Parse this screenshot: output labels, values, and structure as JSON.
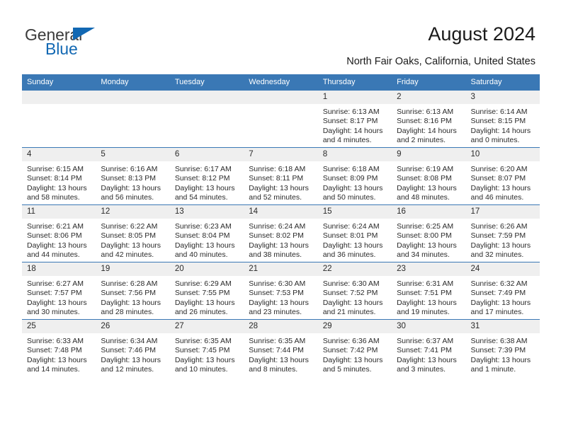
{
  "brand": {
    "name_top": "General",
    "name_bottom": "Blue",
    "triangle_color": "#1268b3",
    "top_color": "#3b3b3b"
  },
  "header": {
    "title": "August 2024",
    "subtitle": "North Fair Oaks, California, United States"
  },
  "theme": {
    "header_blue": "#3a78b5",
    "daynum_band": "#efefef",
    "text": "#2a2a2a"
  },
  "weekday_headers": [
    "Sunday",
    "Monday",
    "Tuesday",
    "Wednesday",
    "Thursday",
    "Friday",
    "Saturday"
  ],
  "labels": {
    "sunrise": "Sunrise:",
    "sunset": "Sunset:",
    "daylight": "Daylight:"
  },
  "weeks": [
    [
      {
        "day": "",
        "empty": true
      },
      {
        "day": "",
        "empty": true
      },
      {
        "day": "",
        "empty": true
      },
      {
        "day": "",
        "empty": true
      },
      {
        "day": "1",
        "sunrise": "Sunrise: 6:13 AM",
        "sunset": "Sunset: 8:17 PM",
        "daylight": "Daylight: 14 hours and 4 minutes."
      },
      {
        "day": "2",
        "sunrise": "Sunrise: 6:13 AM",
        "sunset": "Sunset: 8:16 PM",
        "daylight": "Daylight: 14 hours and 2 minutes."
      },
      {
        "day": "3",
        "sunrise": "Sunrise: 6:14 AM",
        "sunset": "Sunset: 8:15 PM",
        "daylight": "Daylight: 14 hours and 0 minutes."
      }
    ],
    [
      {
        "day": "4",
        "sunrise": "Sunrise: 6:15 AM",
        "sunset": "Sunset: 8:14 PM",
        "daylight": "Daylight: 13 hours and 58 minutes."
      },
      {
        "day": "5",
        "sunrise": "Sunrise: 6:16 AM",
        "sunset": "Sunset: 8:13 PM",
        "daylight": "Daylight: 13 hours and 56 minutes."
      },
      {
        "day": "6",
        "sunrise": "Sunrise: 6:17 AM",
        "sunset": "Sunset: 8:12 PM",
        "daylight": "Daylight: 13 hours and 54 minutes."
      },
      {
        "day": "7",
        "sunrise": "Sunrise: 6:18 AM",
        "sunset": "Sunset: 8:11 PM",
        "daylight": "Daylight: 13 hours and 52 minutes."
      },
      {
        "day": "8",
        "sunrise": "Sunrise: 6:18 AM",
        "sunset": "Sunset: 8:09 PM",
        "daylight": "Daylight: 13 hours and 50 minutes."
      },
      {
        "day": "9",
        "sunrise": "Sunrise: 6:19 AM",
        "sunset": "Sunset: 8:08 PM",
        "daylight": "Daylight: 13 hours and 48 minutes."
      },
      {
        "day": "10",
        "sunrise": "Sunrise: 6:20 AM",
        "sunset": "Sunset: 8:07 PM",
        "daylight": "Daylight: 13 hours and 46 minutes."
      }
    ],
    [
      {
        "day": "11",
        "sunrise": "Sunrise: 6:21 AM",
        "sunset": "Sunset: 8:06 PM",
        "daylight": "Daylight: 13 hours and 44 minutes."
      },
      {
        "day": "12",
        "sunrise": "Sunrise: 6:22 AM",
        "sunset": "Sunset: 8:05 PM",
        "daylight": "Daylight: 13 hours and 42 minutes."
      },
      {
        "day": "13",
        "sunrise": "Sunrise: 6:23 AM",
        "sunset": "Sunset: 8:04 PM",
        "daylight": "Daylight: 13 hours and 40 minutes."
      },
      {
        "day": "14",
        "sunrise": "Sunrise: 6:24 AM",
        "sunset": "Sunset: 8:02 PM",
        "daylight": "Daylight: 13 hours and 38 minutes."
      },
      {
        "day": "15",
        "sunrise": "Sunrise: 6:24 AM",
        "sunset": "Sunset: 8:01 PM",
        "daylight": "Daylight: 13 hours and 36 minutes."
      },
      {
        "day": "16",
        "sunrise": "Sunrise: 6:25 AM",
        "sunset": "Sunset: 8:00 PM",
        "daylight": "Daylight: 13 hours and 34 minutes."
      },
      {
        "day": "17",
        "sunrise": "Sunrise: 6:26 AM",
        "sunset": "Sunset: 7:59 PM",
        "daylight": "Daylight: 13 hours and 32 minutes."
      }
    ],
    [
      {
        "day": "18",
        "sunrise": "Sunrise: 6:27 AM",
        "sunset": "Sunset: 7:57 PM",
        "daylight": "Daylight: 13 hours and 30 minutes."
      },
      {
        "day": "19",
        "sunrise": "Sunrise: 6:28 AM",
        "sunset": "Sunset: 7:56 PM",
        "daylight": "Daylight: 13 hours and 28 minutes."
      },
      {
        "day": "20",
        "sunrise": "Sunrise: 6:29 AM",
        "sunset": "Sunset: 7:55 PM",
        "daylight": "Daylight: 13 hours and 26 minutes."
      },
      {
        "day": "21",
        "sunrise": "Sunrise: 6:30 AM",
        "sunset": "Sunset: 7:53 PM",
        "daylight": "Daylight: 13 hours and 23 minutes."
      },
      {
        "day": "22",
        "sunrise": "Sunrise: 6:30 AM",
        "sunset": "Sunset: 7:52 PM",
        "daylight": "Daylight: 13 hours and 21 minutes."
      },
      {
        "day": "23",
        "sunrise": "Sunrise: 6:31 AM",
        "sunset": "Sunset: 7:51 PM",
        "daylight": "Daylight: 13 hours and 19 minutes."
      },
      {
        "day": "24",
        "sunrise": "Sunrise: 6:32 AM",
        "sunset": "Sunset: 7:49 PM",
        "daylight": "Daylight: 13 hours and 17 minutes."
      }
    ],
    [
      {
        "day": "25",
        "sunrise": "Sunrise: 6:33 AM",
        "sunset": "Sunset: 7:48 PM",
        "daylight": "Daylight: 13 hours and 14 minutes."
      },
      {
        "day": "26",
        "sunrise": "Sunrise: 6:34 AM",
        "sunset": "Sunset: 7:46 PM",
        "daylight": "Daylight: 13 hours and 12 minutes."
      },
      {
        "day": "27",
        "sunrise": "Sunrise: 6:35 AM",
        "sunset": "Sunset: 7:45 PM",
        "daylight": "Daylight: 13 hours and 10 minutes."
      },
      {
        "day": "28",
        "sunrise": "Sunrise: 6:35 AM",
        "sunset": "Sunset: 7:44 PM",
        "daylight": "Daylight: 13 hours and 8 minutes."
      },
      {
        "day": "29",
        "sunrise": "Sunrise: 6:36 AM",
        "sunset": "Sunset: 7:42 PM",
        "daylight": "Daylight: 13 hours and 5 minutes."
      },
      {
        "day": "30",
        "sunrise": "Sunrise: 6:37 AM",
        "sunset": "Sunset: 7:41 PM",
        "daylight": "Daylight: 13 hours and 3 minutes."
      },
      {
        "day": "31",
        "sunrise": "Sunrise: 6:38 AM",
        "sunset": "Sunset: 7:39 PM",
        "daylight": "Daylight: 13 hours and 1 minute."
      }
    ]
  ]
}
